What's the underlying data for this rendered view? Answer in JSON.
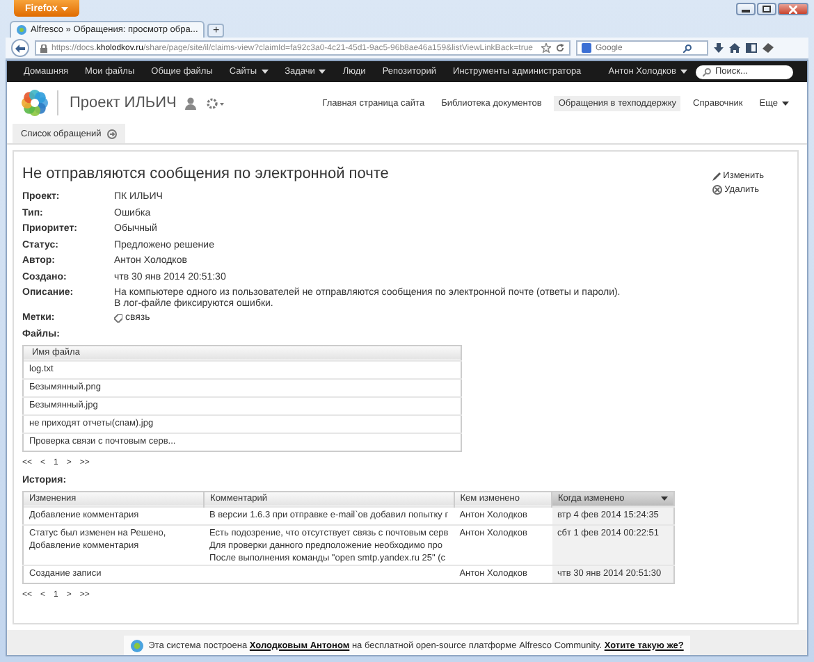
{
  "browser": {
    "app_button": "Firefox",
    "tab_title": "Alfresco » Обращения: просмотр обра...",
    "new_tab": "+",
    "url": "https://docs.**kholodkov.ru**/share/page/site/il/claims-view?claimId=fa92c3a0-4c21-45d1-9ac5-96b8ae46a159&listViewLinkBack=true",
    "search_placeholder": "Google"
  },
  "nav": {
    "items": [
      {
        "label": "Домашняя",
        "dropdown": false
      },
      {
        "label": "Мои файлы",
        "dropdown": false
      },
      {
        "label": "Общие файлы",
        "dropdown": false
      },
      {
        "label": "Сайты",
        "dropdown": true
      },
      {
        "label": "Задачи",
        "dropdown": true
      },
      {
        "label": "Люди",
        "dropdown": false
      },
      {
        "label": "Репозиторий",
        "dropdown": false
      },
      {
        "label": "Инструменты администратора",
        "dropdown": false
      }
    ],
    "user": "Антон Холодков",
    "search_placeholder": "Поиск..."
  },
  "site": {
    "title": "Проект ИЛЬИЧ",
    "links": [
      {
        "label": "Главная страница сайта",
        "selected": false
      },
      {
        "label": "Библиотека документов",
        "selected": false
      },
      {
        "label": "Обращения в техподдержку",
        "selected": true
      },
      {
        "label": "Справочник",
        "selected": false
      }
    ],
    "more": "Еще"
  },
  "subnav": {
    "tab": "Список обращений"
  },
  "claim": {
    "title": "Не отправляются сообщения по электронной почте",
    "actions": [
      {
        "kind": "edit",
        "label": "Изменить"
      },
      {
        "kind": "delete",
        "label": "Удалить"
      }
    ],
    "fields": [
      {
        "kind": "text",
        "label": "Проект:",
        "lines": [
          "ПК ИЛЬИЧ"
        ]
      },
      {
        "kind": "text",
        "label": "Тип:",
        "lines": [
          "Ошибка"
        ]
      },
      {
        "kind": "text",
        "label": "Приоритет:",
        "lines": [
          "Обычный"
        ]
      },
      {
        "kind": "text",
        "label": "Статус:",
        "lines": [
          "Предложено решение"
        ]
      },
      {
        "kind": "text",
        "label": "Автор:",
        "lines": [
          "Антон Холодков"
        ]
      },
      {
        "kind": "text",
        "label": "Создано:",
        "lines": [
          "чтв 30 янв 2014 20:51:30"
        ]
      },
      {
        "kind": "text",
        "label": "Описание:",
        "lines": [
          "На компьютере одного из пользователей не отправляются сообщения по электронной почте (ответы и пароли).",
          "В лог-файле фиксируются ошибки."
        ]
      },
      {
        "kind": "tag",
        "label": "Метки:",
        "lines": [
          "связь"
        ]
      }
    ]
  },
  "files": {
    "heading": "Файлы:",
    "column": "Имя файла",
    "rows": [
      "log.txt",
      "Безымянный.png",
      "Безымянный.jpg",
      "не приходят отчеты(спам).jpg",
      "Проверка связи с почтовым серв..."
    ],
    "pager": [
      "<<",
      "<",
      "1",
      ">",
      ">>"
    ]
  },
  "history": {
    "heading": "История:",
    "columns": [
      {
        "label": "Изменения",
        "sorted": false
      },
      {
        "label": "Комментарий",
        "sorted": false
      },
      {
        "label": "Кем изменено",
        "sorted": false
      },
      {
        "label": "Когда изменено",
        "sorted": true
      }
    ],
    "rows": [
      {
        "change": [
          "Добавление комментария"
        ],
        "comment": [
          "В версии 1.6.3 при отправке e-mail`ов добавил попытку г"
        ],
        "author": "Антон Холодков",
        "date": "втр 4 фев 2014 15:24:35"
      },
      {
        "change": [
          "Статус был изменен на Решено,",
          "Добавление комментария"
        ],
        "comment": [
          "Есть подозрение, что отсутствует связь с почтовым серв",
          "Для проверки данного предположение необходимо про",
          "После выполнения команды \"open smtp.yandex.ru 25\" (с"
        ],
        "author": "Антон Холодков",
        "date": "сбт 1 фев 2014 00:22:51"
      },
      {
        "change": [
          "Создание записи"
        ],
        "comment": [],
        "author": "Антон Холодков",
        "date": "чтв 30 янв 2014 20:51:30"
      }
    ],
    "pager": [
      "<<",
      "<",
      "1",
      ">",
      ">>"
    ]
  },
  "footer": {
    "prefix": "Эта система построена",
    "author_link": "Холодковым Антоном",
    "middle": "на бесплатной open-source платформе Alfresco Community.",
    "cta_link": "Хотите такую же?"
  }
}
